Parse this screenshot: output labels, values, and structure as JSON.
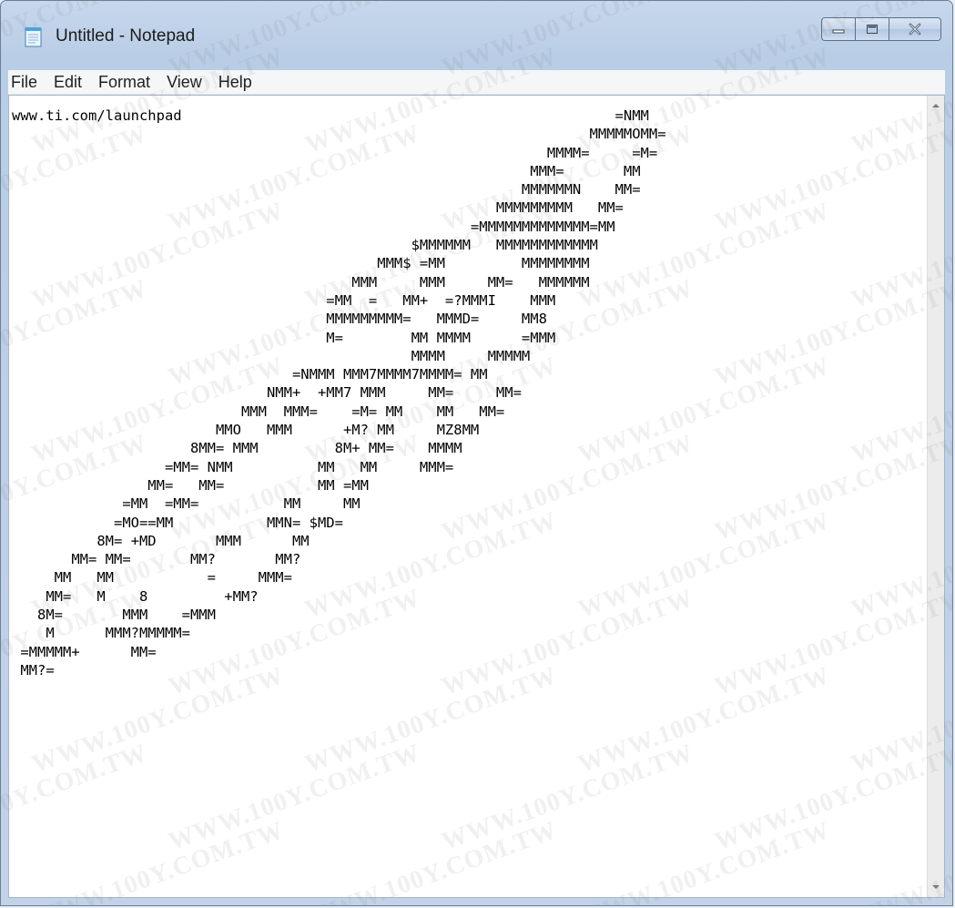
{
  "window": {
    "title": "Untitled - Notepad"
  },
  "menubar": {
    "items": [
      "File",
      "Edit",
      "Format",
      "View",
      "Help"
    ]
  },
  "editor": {
    "content": "www.ti.com/launchpad                                                   =NMM\n                                                                    MMMMMOMM=\n                                                               MMMM=     =M=\n                                                             MMM=       MM\n                                                            MMMMMMN    MM=\n                                                         MMMMMMMMM   MM=\n                                                      =MMMMMMMMMMMMM=MM\n                                               $MMMMMM   MMMMMMMMMMMM\n                                           MMM$ =MM         MMMMMMMM\n                                        MMM     MMM     MM=   MMMMMM\n                                     =MM  =   MM+  =?MMMI    MMM\n                                     MMMMMMMMM=   MMMD=     MM8\n                                     M=        MM MMMM      =MMM\n                                               MMMM     MMMMM\n                                 =NMMM MMM7MMMM7MMMM= MM\n                              NMM+  +MM7 MMM     MM=     MM=\n                           MMM  MMM=    =M= MM    MM   MM=\n                        MMO   MMM      +M? MM     MZ8MM\n                     8MM= MMM         8M+ MM=    MMMM\n                  =MM= NMM          MM   MM     MMM=\n                MM=   MM=           MM =MM\n             =MM  =MM=          MM     MM\n            =MO==MM           MMN= $MD=\n          8M= +MD       MMM      MM\n       MM= MM=       MM?       MM?\n     MM   MM           =     MMM=\n    MM=   M    8         +MM?\n   8M=       MMM    =MMM\n    M      MMM?MMMMM=\n =MMMMM+      MM=\n MM?="
  },
  "watermark": {
    "text": "WWW.100Y.COM.TW"
  },
  "colors": {
    "titlebar": "#b9cde6",
    "menubar": "#f5f6f7",
    "editor_bg": "#ffffff"
  }
}
